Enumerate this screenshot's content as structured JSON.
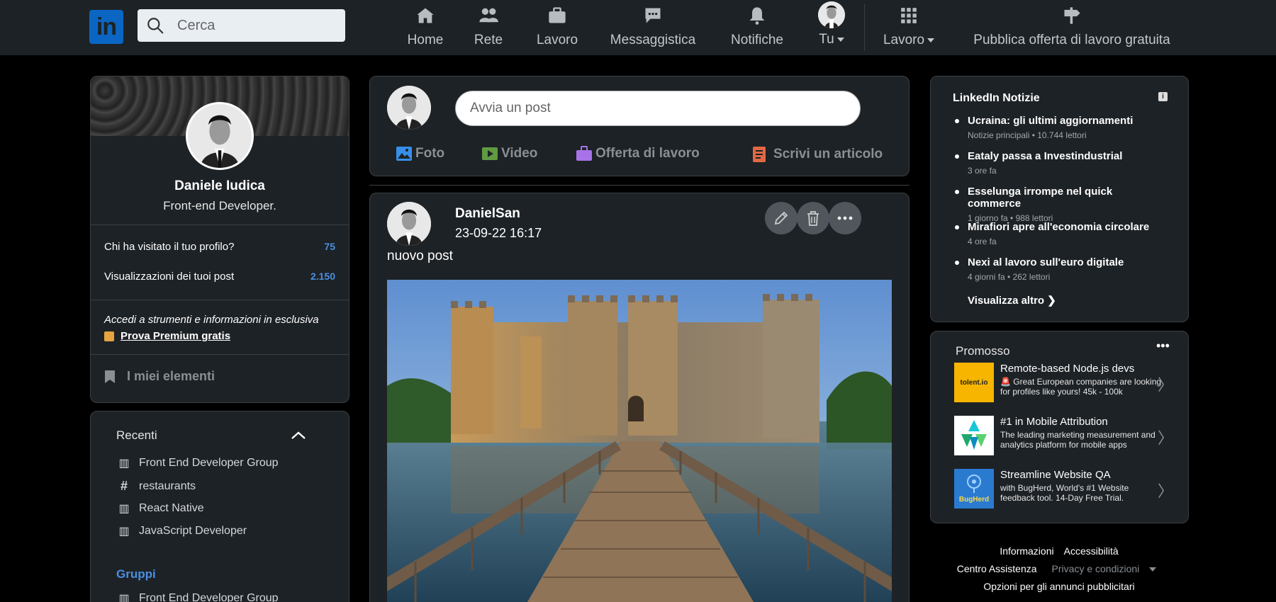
{
  "nav": {
    "logo_text": "in",
    "search_placeholder": "Cerca",
    "items": [
      {
        "label": "Home",
        "icon": "home-icon"
      },
      {
        "label": "Rete",
        "icon": "people-icon"
      },
      {
        "label": "Lavoro",
        "icon": "briefcase-icon"
      },
      {
        "label": "Messaggistica",
        "icon": "message-icon"
      },
      {
        "label": "Notifiche",
        "icon": "bell-icon"
      },
      {
        "label": "Tu",
        "icon": "avatar"
      },
      {
        "label": "Lavoro",
        "icon": "grid-icon"
      },
      {
        "label": "Pubblica offerta di lavoro gratuita",
        "icon": "signpost-icon"
      }
    ]
  },
  "profile": {
    "name": "Daniele Iudica",
    "title": "Front-end Developer.",
    "stats": [
      {
        "label": "Chi ha visitato il tuo profilo?",
        "value": "75"
      },
      {
        "label": "Visualizzazioni dei tuoi post",
        "value": "2.150"
      }
    ],
    "premium_text": "Accedi a strumenti e informazioni in esclusiva",
    "premium_link": "Prova Premium gratis",
    "my_items": "I miei elementi"
  },
  "recent": {
    "title": "Recenti",
    "items": [
      {
        "label": "Front End Developer Group",
        "icon": "group-icon"
      },
      {
        "label": "restaurants",
        "icon": "hashtag-icon"
      },
      {
        "label": "React Native",
        "icon": "group-icon"
      },
      {
        "label": "JavaScript Developer",
        "icon": "group-icon"
      }
    ],
    "groups_title": "Gruppi",
    "groups_first": "Front End Developer Group"
  },
  "composer": {
    "placeholder": "Avvia un post",
    "actions": [
      {
        "label": "Foto",
        "color": "#378fe9"
      },
      {
        "label": "Video",
        "color": "#5f9b41"
      },
      {
        "label": "Offerta di lavoro",
        "color": "#a872e8"
      },
      {
        "label": "Scrivi un articolo",
        "color": "#e16745"
      }
    ]
  },
  "post": {
    "author": "DanielSan",
    "date": "23-09-22 16:17",
    "text": "nuovo post"
  },
  "news": {
    "title": "LinkedIn Notizie",
    "items": [
      {
        "headline": "Ucraina: gli ultimi aggiornamenti",
        "meta": "Notizie principali • 10.744 lettori"
      },
      {
        "headline": "Eataly passa a Investindustrial",
        "meta": "3 ore fa"
      },
      {
        "headline": "Esselunga irrompe nel quick commerce",
        "meta": "1 giorno fa • 988 lettori"
      },
      {
        "headline": "Mirafiori apre all'economia circolare",
        "meta": "4 ore fa"
      },
      {
        "headline": "Nexi al lavoro sull'euro digitale",
        "meta": "4 giorni fa • 262 lettori"
      }
    ],
    "more": "Visualizza altro ❯"
  },
  "promo": {
    "title": "Promosso",
    "ads": [
      {
        "title": "Remote-based Node.js devs",
        "desc": "🚨 Great European companies are looking for profiles like yours! 45k - 100k",
        "logo_text": "tolent.io"
      },
      {
        "title": "#1 in Mobile Attribution",
        "desc": "The leading marketing measurement and analytics platform for mobile apps",
        "logo_text": ""
      },
      {
        "title": "Streamline Website QA",
        "desc": "with BugHerd, World's #1 Website feedback tool. 14-Day Free Trial.",
        "logo_text": "BugHerd"
      }
    ]
  },
  "footer": {
    "links": [
      "Informazioni",
      "Accessibilità",
      "Centro Assistenza",
      "Privacy e condizioni",
      "Opzioni per gli annunci pubblicitari"
    ]
  }
}
